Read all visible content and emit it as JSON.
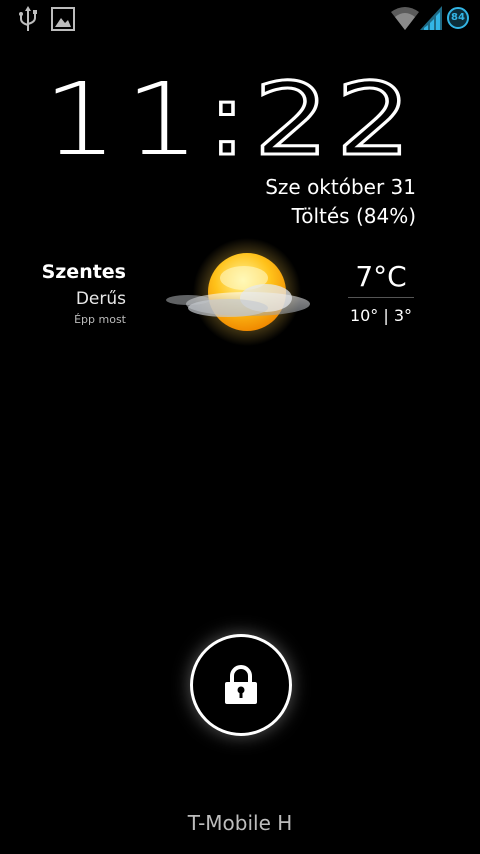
{
  "status_bar": {
    "left_icons": [
      "usb-icon",
      "image-notification-icon"
    ],
    "right_icons": [
      "wifi-icon",
      "cell-signal-icon"
    ],
    "battery_level": "84",
    "accent_color": "#33b5e5"
  },
  "clock": {
    "hours": "11",
    "separator": ":",
    "minutes": "22"
  },
  "date_text": "Sze október 31",
  "charging_text": "Töltés (84%)",
  "weather": {
    "city": "Szentes",
    "condition": "Derűs",
    "updated": "Épp most",
    "icon": "sun-with-clouds-icon",
    "temperature": "7°C",
    "high_low": "10° | 3°"
  },
  "lock_icon": "padlock-icon",
  "carrier": "T-Mobile H"
}
